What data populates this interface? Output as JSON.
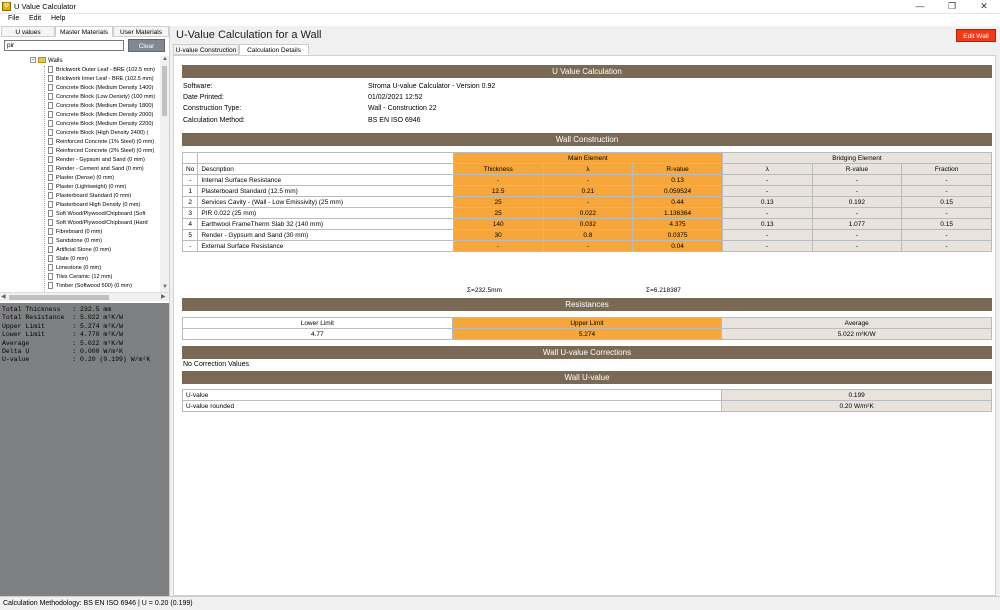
{
  "window": {
    "title": "U Value Calculator",
    "minimize": "—",
    "restore": "❐",
    "close": "✕"
  },
  "menu": [
    "File",
    "Edit",
    "Help"
  ],
  "left": {
    "tabs": [
      "U values",
      "Master Materials",
      "User Materials"
    ],
    "search": {
      "value": "pir",
      "placeholder": ""
    },
    "clear_label": "Clear",
    "tree_root": "Walls",
    "items": [
      "Brickwork Outer Leaf - BRE (102.5 mm)",
      "Brickwork Inner Leaf - BRE (102.5 mm)",
      "Concrete Block (Medium Density 1400)",
      "Concrete Block (Low Density) (100 mm)",
      "Concrete Block (Medium Density 1800)",
      "Concrete Block (Medium Density 2000)",
      "Concrete Block (Medium Density 2200)",
      "Concrete Block (High Density 2400) (",
      "Reinforced Concrete (1% Steel) (0 mm)",
      "Reinforced Concrete (2% Steel) (0 mm)",
      "Render - Gypsum and Sand (0 mm)",
      "Render - Cement and Sand (0 mm)",
      "Plaster (Dense) (0 mm)",
      "Plaster (Lightweight) (0 mm)",
      "Plasterboard Standard (0 mm)",
      "Plasterboard High Density (0 mm)",
      "Soft Wood/Plywood/Chipboard (Soft",
      "Soft Wood/Plywood/Chipboard (Hard",
      "Fibreboard (0 mm)",
      "Sandstone (0 mm)",
      "Artificial Stone (0 mm)",
      "Slate (0 mm)",
      "Limestone  (0 mm)",
      "Tiles Ceramic (12 mm)",
      "Timber (Softwood 500) (0 mm)"
    ],
    "summary": [
      "Total Thickness   : 232.5 mm",
      "Total Resistance  : 5.022 m²K/W",
      "Upper Limit       : 5.274 m²K/W",
      "Lower Limit       : 4.770 m²K/W",
      "Average           : 5.022 m²K/W",
      "Delta U           : 0.000 W/m²K",
      "U-value           : 0.20 (0.199) W/m²K"
    ]
  },
  "main": {
    "title": "U-Value Calculation for a Wall",
    "edit_label": "Edit Wall",
    "tabs": [
      "U-value Construction",
      "Calculation Details"
    ],
    "sections": {
      "calc": "U Value Calculation",
      "wall": "Wall Construction",
      "res": "Resistances",
      "corr": "Wall U-value Corrections",
      "uval": "Wall U-value"
    },
    "info": [
      {
        "k": "Software:",
        "v": "Stroma U-value Calculator - Version 0.92"
      },
      {
        "k": "Date Printed:",
        "v": "01/02/2021 12:52"
      },
      {
        "k": "Construction Type:",
        "v": "Wall - Construction 22"
      },
      {
        "k": "Calculation Method:",
        "v": "BS EN ISO 6946"
      }
    ],
    "construction": {
      "group_main": "Main Element",
      "group_bridge": "Bridging Element",
      "headers": [
        "No",
        "Description",
        "Thickness",
        "λ",
        "R-value",
        "λ",
        "R-value",
        "Fraction"
      ],
      "rows": [
        [
          "-",
          "Internal Surface Resistance",
          "-",
          "-",
          "0.13",
          "-",
          "-",
          "-"
        ],
        [
          "1",
          "Plasterboard Standard (12.5 mm)",
          "12.5",
          "0.21",
          "0.059524",
          "-",
          "-",
          "-"
        ],
        [
          "2",
          "Services Cavity - (Wall - Low Emissivity) (25 mm)",
          "25",
          "-",
          "0.44",
          "0.13",
          "0.192",
          "0.15"
        ],
        [
          "3",
          "PIR 0.022 (25 mm)",
          "25",
          "0.022",
          "1.136364",
          "-",
          "-",
          "-"
        ],
        [
          "4",
          "Earthwool FrameTherm Slab 32 (140 mm)",
          "140",
          "0.032",
          "4.375",
          "0.13",
          "1.077",
          "0.15"
        ],
        [
          "5",
          "Render - Gypsum and Sand (30 mm)",
          "30",
          "0.8",
          "0.0375",
          "-",
          "-",
          "-"
        ],
        [
          "-",
          "External Surface Resistance",
          "-",
          "-",
          "0.04",
          "-",
          "-",
          "-"
        ]
      ],
      "sum_thickness": "Σ=232.5mm",
      "sum_r": "Σ=6.218387"
    },
    "resistances": {
      "headers": [
        "Lower Limit",
        "Upper Limit",
        "Average"
      ],
      "values": [
        "4.77",
        "5.274",
        "5.022 m²K/W"
      ]
    },
    "corrections": "No Correction Values",
    "uvalue": [
      {
        "k": "U-value",
        "v": "0.199"
      },
      {
        "k": "U-value rounded",
        "v": "0.20 W/m²K"
      }
    ]
  },
  "status": "Calculation Methodology: BS EN ISO 6946  |  U = 0.20 (0.199)",
  "colors": {
    "section_bar": "#7a6a55",
    "main_element": "#f6a63b",
    "bridging": "#e8e3dc",
    "edit_button": "#f03a17"
  }
}
